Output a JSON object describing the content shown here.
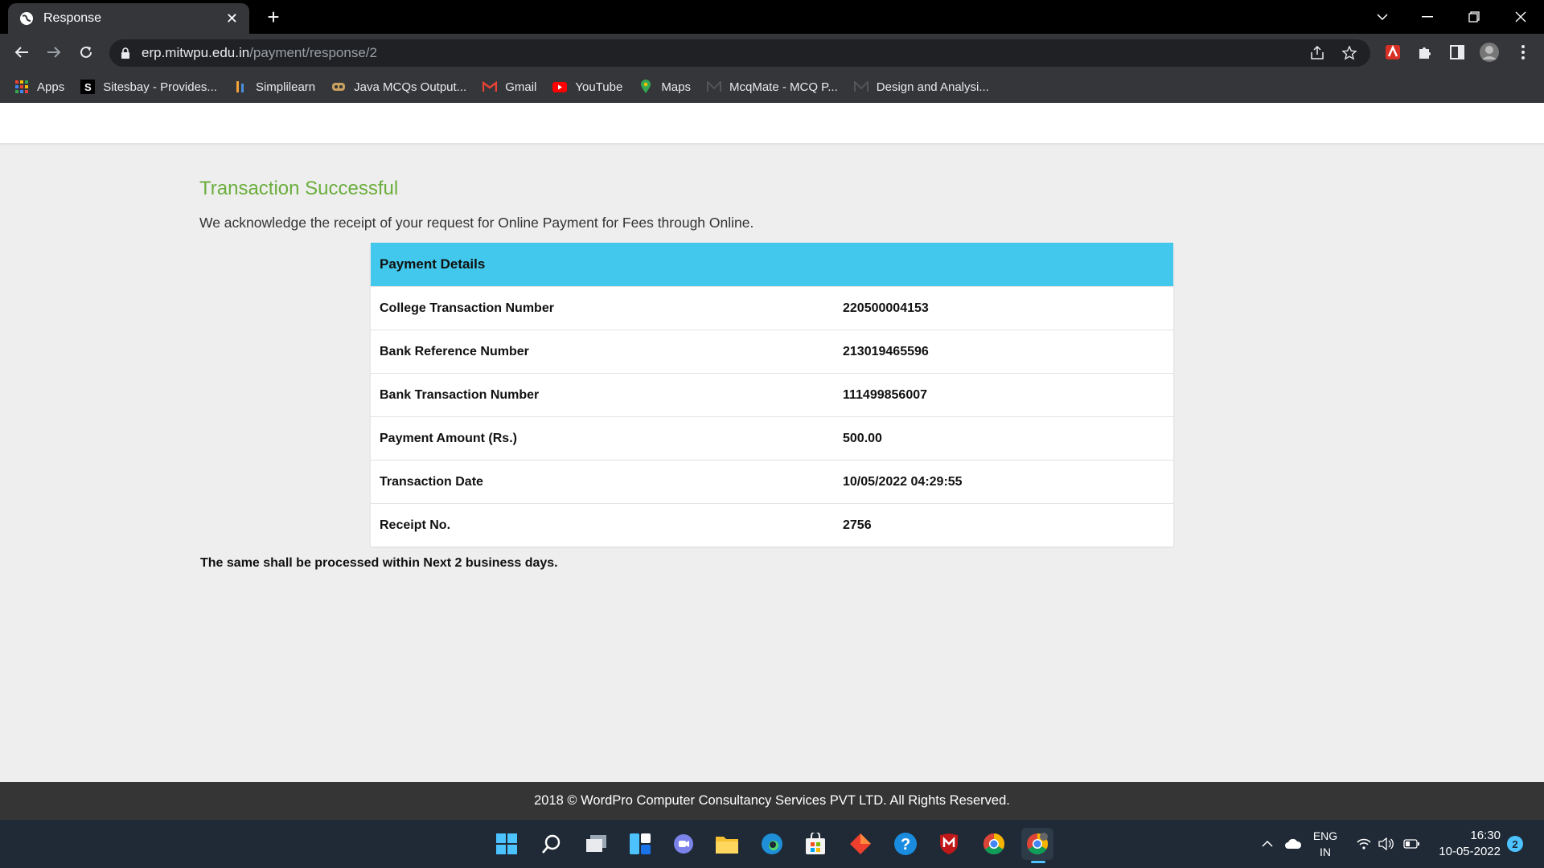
{
  "browser": {
    "tab_title": "Response",
    "url_host": "erp.mitwpu.edu.in",
    "url_path": "/payment/response/2",
    "bookmarks": [
      {
        "label": "Apps"
      },
      {
        "label": "Sitesbay - Provides..."
      },
      {
        "label": "Simplilearn"
      },
      {
        "label": "Java MCQs Output..."
      },
      {
        "label": "Gmail"
      },
      {
        "label": "YouTube"
      },
      {
        "label": "Maps"
      },
      {
        "label": "McqMate - MCQ P..."
      },
      {
        "label": "Design and Analysi..."
      }
    ]
  },
  "page": {
    "heading": "Transaction Successful",
    "ack": "We acknowledge the receipt of your request for Online Payment for Fees through Online.",
    "details_title": "Payment Details",
    "rows": [
      {
        "label": "College Transaction Number",
        "value": "220500004153"
      },
      {
        "label": "Bank Reference Number",
        "value": "213019465596"
      },
      {
        "label": "Bank Transaction Number",
        "value": "111499856007"
      },
      {
        "label": "Payment Amount (Rs.)",
        "value": "500.00"
      },
      {
        "label": "Transaction Date",
        "value": "10/05/2022 04:29:55"
      },
      {
        "label": "Receipt No.",
        "value": "2756"
      }
    ],
    "note": "The same shall be processed within Next 2 business days.",
    "footer": "2018 © WordPro Computer Consultancy Services PVT LTD. All Rights Reserved."
  },
  "taskbar": {
    "lang_line1": "ENG",
    "lang_line2": "IN",
    "time": "16:30",
    "date": "10-05-2022",
    "notification_count": "2"
  },
  "colors": {
    "success_green": "#6aae3d",
    "details_header": "#42c8ec",
    "footer_bg": "#353535"
  }
}
